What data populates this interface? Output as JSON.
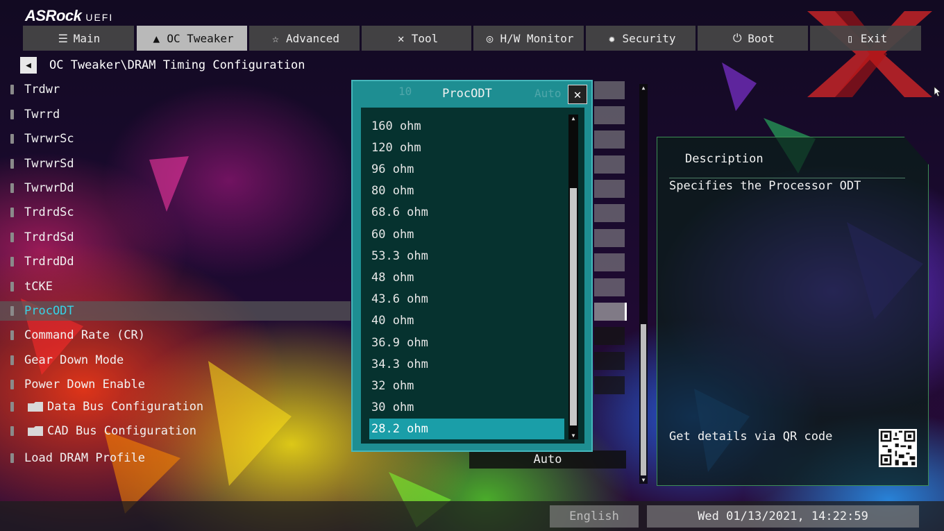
{
  "brand": {
    "name": "ASRock",
    "suffix": "UEFI"
  },
  "tabs": [
    {
      "label": "Main",
      "icon": "list-icon"
    },
    {
      "label": "OC Tweaker",
      "icon": "rocket-icon",
      "active": true
    },
    {
      "label": "Advanced",
      "icon": "star-icon"
    },
    {
      "label": "Tool",
      "icon": "tools-icon"
    },
    {
      "label": "H/W Monitor",
      "icon": "monitor-gauge-icon"
    },
    {
      "label": "Security",
      "icon": "shield-gear-icon"
    },
    {
      "label": "Boot",
      "icon": "power-icon"
    },
    {
      "label": "Exit",
      "icon": "exit-door-icon"
    }
  ],
  "breadcrumb": {
    "path": "OC Tweaker\\DRAM Timing Configuration"
  },
  "settings": [
    {
      "label": "Trdwr"
    },
    {
      "label": "Twrrd"
    },
    {
      "label": "TwrwrSc"
    },
    {
      "label": "TwrwrSd"
    },
    {
      "label": "TwrwrDd"
    },
    {
      "label": "TrdrdSc"
    },
    {
      "label": "TrdrdSd"
    },
    {
      "label": "TrdrdDd"
    },
    {
      "label": "tCKE"
    },
    {
      "label": "ProcODT",
      "selected": true
    },
    {
      "label": "Command Rate (CR)"
    },
    {
      "label": "Gear Down Mode"
    },
    {
      "label": "Power Down Enable"
    },
    {
      "label": "Data Bus Configuration",
      "folder": true
    },
    {
      "label": "CAD Bus Configuration",
      "folder": true
    },
    {
      "label": "Load DRAM Profile"
    }
  ],
  "load_profile_value": "Auto",
  "popup": {
    "title": "ProcODT",
    "ghost_left": "10",
    "ghost_right": "Auto",
    "options": [
      "160 ohm",
      "120 ohm",
      "96 ohm",
      "80 ohm",
      "68.6 ohm",
      "60 ohm",
      "53.3 ohm",
      "48 ohm",
      "43.6 ohm",
      "40 ohm",
      "36.9 ohm",
      "34.3 ohm",
      "32 ohm",
      "30 ohm",
      "28.2 ohm"
    ],
    "selected": "28.2 ohm"
  },
  "description": {
    "title": "Description",
    "text": "Specifies the Processor ODT",
    "qr_label": "Get details via QR code"
  },
  "footer": {
    "language": "English",
    "datetime": "Wed 01/13/2021, 14:22:59"
  },
  "colors": {
    "accent": "#36d3e6",
    "popup": "#1e8e92",
    "selected_option": "#1a9ea8"
  }
}
